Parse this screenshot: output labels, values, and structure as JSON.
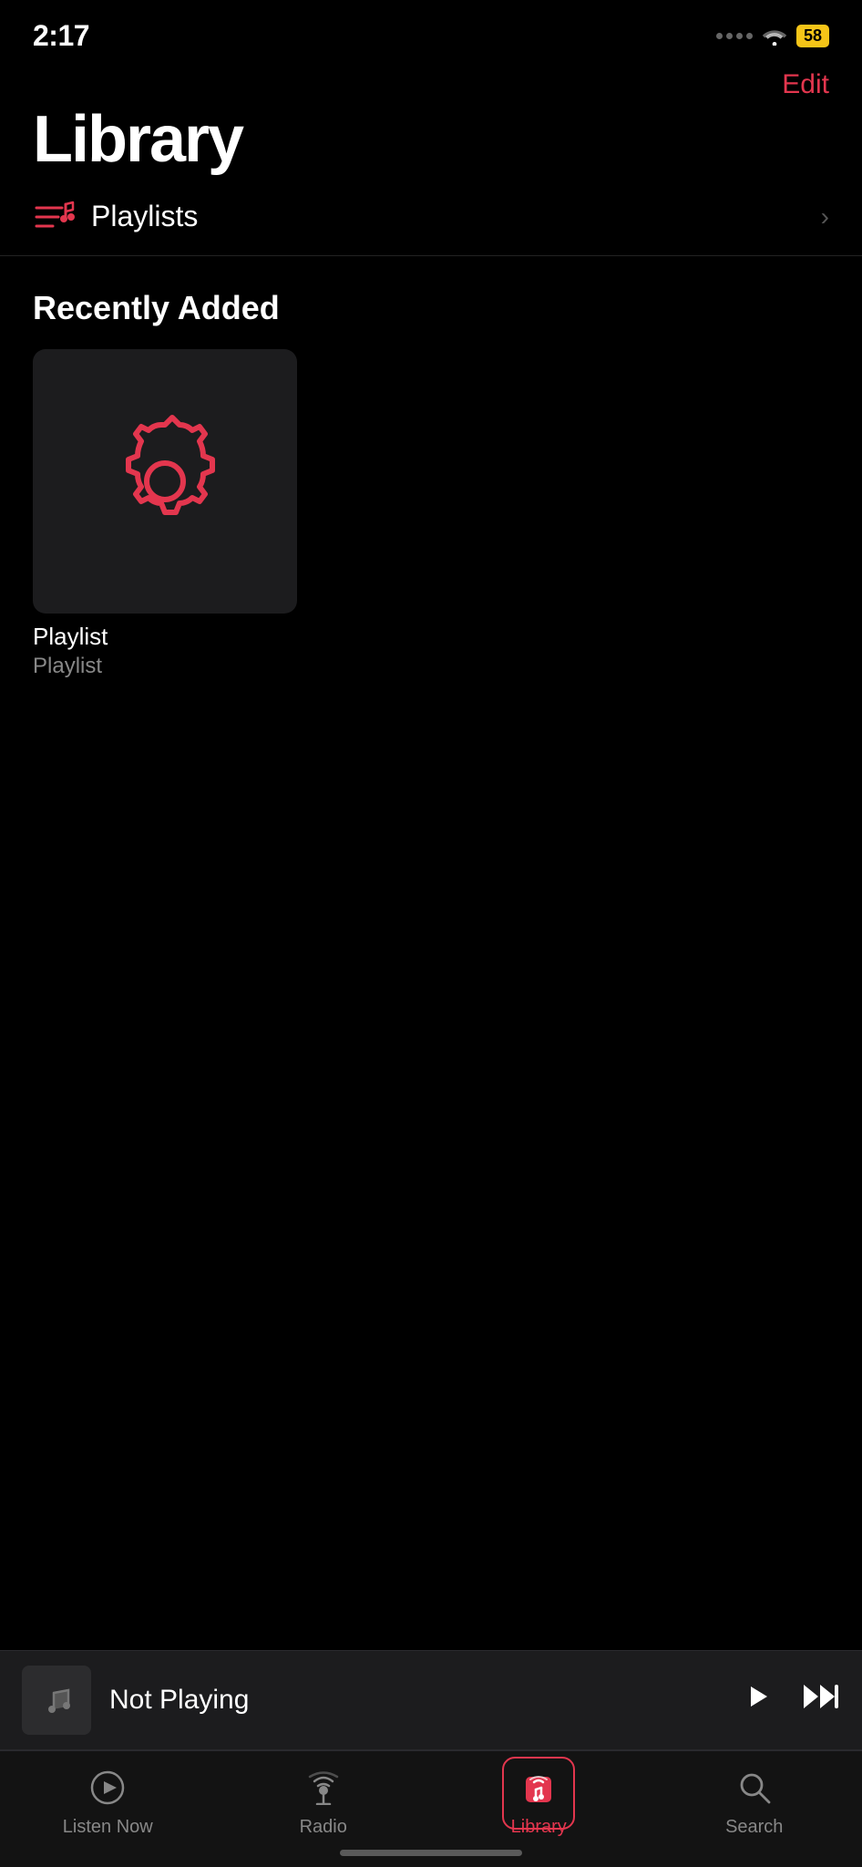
{
  "statusBar": {
    "time": "2:17",
    "battery": "58",
    "batteryIcon": "battery"
  },
  "header": {
    "editLabel": "Edit"
  },
  "pageTitle": "Library",
  "playlists": {
    "label": "Playlists",
    "icon": "music-list-icon"
  },
  "recentlyAdded": {
    "sectionTitle": "Recently Added",
    "items": [
      {
        "title": "Playlist",
        "subtitle": "Playlist",
        "artIcon": "gear-icon"
      }
    ]
  },
  "miniPlayer": {
    "status": "Not Playing",
    "playLabel": "▶",
    "ffLabel": "⏭"
  },
  "tabBar": {
    "tabs": [
      {
        "id": "listen-now",
        "label": "Listen Now",
        "icon": "play-circle-icon",
        "active": false
      },
      {
        "id": "radio",
        "label": "Radio",
        "icon": "radio-icon",
        "active": false
      },
      {
        "id": "library",
        "label": "Library",
        "icon": "library-icon",
        "active": true
      },
      {
        "id": "search",
        "label": "Search",
        "icon": "search-icon",
        "active": false
      }
    ]
  },
  "colors": {
    "accent": "#e3364e",
    "background": "#000",
    "surface": "#1c1c1e",
    "textSecondary": "#888"
  }
}
